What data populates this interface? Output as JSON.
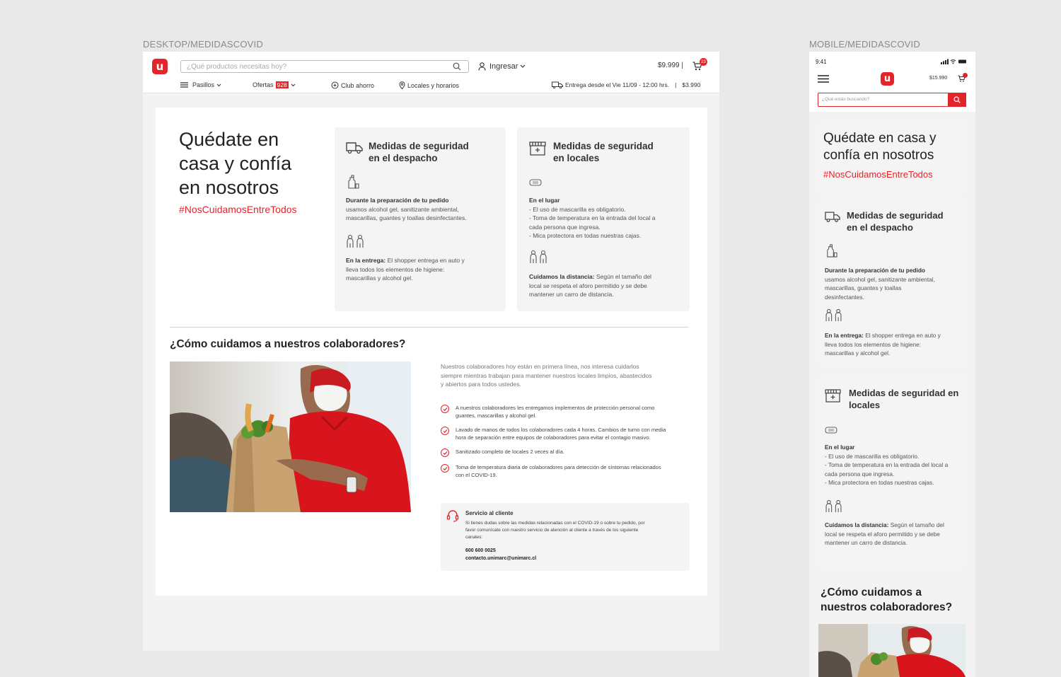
{
  "labels": {
    "desktop": "DESKTOP/MEDIDASCOVID",
    "mobile": "MOBILE/MEDIDASCOVID"
  },
  "brand": {
    "logo": "u",
    "color": "#e3242b"
  },
  "header": {
    "search_placeholder": "¿Qué productos necesitas hoy?",
    "login": "Ingresar",
    "cart_total": "$9.999",
    "cart_sep": "|",
    "cart_badge": "23",
    "nav": {
      "aisles": "Pasillos",
      "offers": "Ofertas",
      "offers_badge": "928",
      "club": "Club ahorro",
      "stores": "Locales y horarios"
    },
    "delivery": "Entrega desde el Vie 11/09 - 12:00 hrs.",
    "delivery_sep": "|",
    "delivery_price": "$3.990"
  },
  "hero": {
    "title": "Quédate en casa y confía en nosotros",
    "hashtag": "#NosCuidamosEntreTodos"
  },
  "card_dispatch": {
    "title": "Medidas de seguridad en el despacho",
    "item1_title": "Durante la preparación de tu pedido",
    "item1_text": "usamos alcohol gel, sanitizante ambiental, mascarillas, guantes y toallas desinfectantes.",
    "item2_title": "En la entrega:",
    "item2_text": "El shopper entrega en auto y lleva todos los elementos de higiene: mascarillas y alcohol gel."
  },
  "card_stores": {
    "title": "Medidas de seguridad en locales",
    "item1_title": "En el lugar",
    "item1_lines": [
      "- El uso de mascarilla es obligatorio.",
      "- Toma de temperatura en la entrada del local a cada persona que ingresa.",
      "- Mica protectora en todas nuestras cajas."
    ],
    "item2_title": "Cuidamos la distancia:",
    "item2_text": "Según el tamaño del local se respeta el aforo permitido y se debe mantener un carro de distancia."
  },
  "collab": {
    "title": "¿Cómo cuidamos a nuestros colaboradores?",
    "intro": "Nuestros colaboradores hoy están en primera línea, nos interesa cuidarlos siempre mientras trabajan para mantener nuestros locales limpios, abastecidos y abiertos para todos ustedes.",
    "items": [
      "A nuestros colaboradores les entregamos implementos de protección personal como guantes, mascarillas y alcohol gel.",
      "Lavado de manos de todos los colaboradores cada 4 horas. Cambios de turno con media hora de separación entre equipos de colaboradores para evitar el contagio masivo.",
      "Sanitizado completo de locales 2 veces al día.",
      "Toma de temperatura diaria de colaboradores para detección de síntomas relacionados con el COVID-19."
    ]
  },
  "service": {
    "title": "Servicio al cliente",
    "text": "Si tienes dudas sobre las medidas relacionadas con el COVID-19 o sobre tu pedido, por favor comunícate con nuestro servicio de atención al cliente a través de los siguiente canales:",
    "phone": "600 600 0025",
    "email": "contacto.unimarc@unimarc.cl"
  },
  "mobile": {
    "time": "9:41",
    "cart_total": "$15.990",
    "search_placeholder": "¿Qué estás buscando?"
  }
}
